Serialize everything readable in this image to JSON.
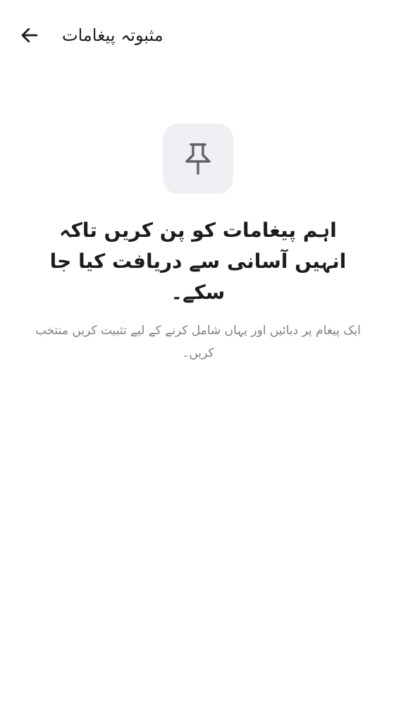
{
  "header": {
    "title": "مثبوتہ پیغامات",
    "back_icon": "arrow-left-icon"
  },
  "empty_state": {
    "icon": "pin-icon",
    "heading": "اہم پیغامات کو پن کریں تاکہ انہیں آسانی سے دریافت کیا جا سکے۔",
    "subtext": "ایک پیغام پر دبائیں اور یہاں شامل کرنے کے لیے تثبیت کریں منتخب کریں۔"
  },
  "colors": {
    "tile_background": "#eef0f3",
    "icon": "#5f6368",
    "subtext": "#7d8187"
  }
}
